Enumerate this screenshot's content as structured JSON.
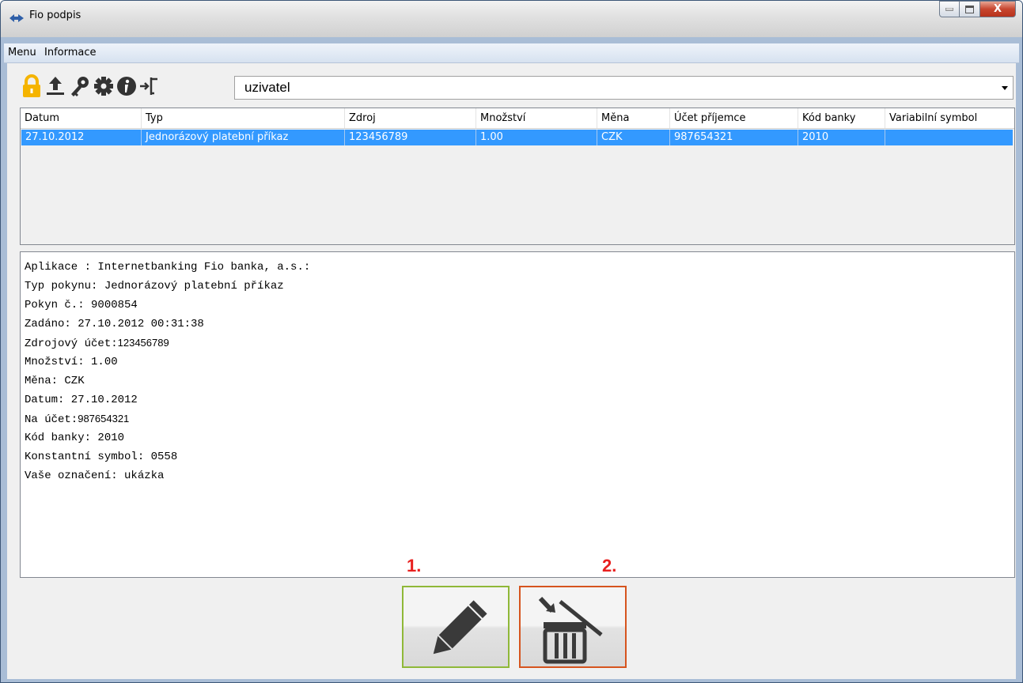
{
  "window": {
    "title": "Fio podpis",
    "icon": "fio-logo-icon",
    "controls": [
      "minimize-icon",
      "maximize-icon",
      "close-icon"
    ],
    "close_glyph": "X"
  },
  "menu": {
    "items": [
      "Menu",
      "Informace"
    ]
  },
  "toolbar": {
    "icons": [
      "lock-icon",
      "upload-icon",
      "key-icon",
      "gear-icon",
      "info-icon",
      "logout-icon"
    ],
    "user_select": {
      "value": "uzivatel"
    }
  },
  "table": {
    "columns": [
      "Datum",
      "Typ",
      "Zdroj",
      "Množství",
      "Měna",
      "Účet příjemce",
      "Kód banky",
      "Variabilní symbol"
    ],
    "rows": [
      [
        "27.10.2012",
        "Jednorázový platební příkaz",
        "123456789",
        "1.00",
        "CZK",
        "987654321",
        "2010",
        ""
      ]
    ],
    "selected_row": 0
  },
  "detail": {
    "lines": [
      {
        "label": "Aplikace : Internetbanking Fio banka, a.s.:",
        "value": ""
      },
      {
        "label": "Typ pokynu: Jednorázový platební příkaz",
        "value": ""
      },
      {
        "label": "Pokyn č.: 9000854",
        "value": ""
      },
      {
        "label": "Zadáno: 27.10.2012 00:31:38",
        "value": ""
      },
      {
        "label": "Zdrojový účet:",
        "value": "123456789"
      },
      {
        "label": "Množství: 1.00",
        "value": ""
      },
      {
        "label": "Měna: CZK",
        "value": ""
      },
      {
        "label": "Datum: 27.10.2012",
        "value": ""
      },
      {
        "label": "Na účet:",
        "value": "987654321"
      },
      {
        "label": "Kód banky: 2010",
        "value": ""
      },
      {
        "label": "Konstantní symbol: 0558",
        "value": ""
      },
      {
        "label": "Vaše označení: ukázka",
        "value": ""
      }
    ]
  },
  "actions": {
    "step1": "1.",
    "step2": "2.",
    "sign_icon": "pencil-icon",
    "delete_icon": "trash-icon",
    "colors": {
      "sign_border": "#8fb838",
      "delete_border": "#d6541e",
      "step_label": "#e8201f"
    }
  },
  "colors": {
    "selection": "#3399ff",
    "lock": "#f5b400"
  }
}
